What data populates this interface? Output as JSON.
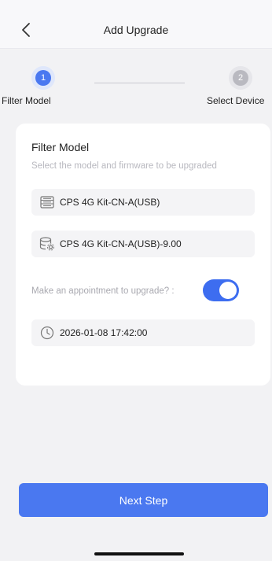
{
  "header": {
    "title": "Add Upgrade"
  },
  "stepper": {
    "steps": [
      {
        "number": "1",
        "label": "Filter Model",
        "active": true
      },
      {
        "number": "2",
        "label": "Select Device",
        "active": false
      }
    ]
  },
  "card": {
    "title": "Filter Model",
    "subtitle": "Select the model and firmware to be upgraded",
    "model_value": "CPS 4G Kit-CN-A(USB)",
    "firmware_value": "CPS 4G Kit-CN-A(USB)-9.00",
    "appointment_label": "Make an appointment to upgrade? :",
    "appointment_enabled": true,
    "datetime_value": "2026-01-08 17:42:00"
  },
  "footer": {
    "next_label": "Next Step"
  },
  "colors": {
    "accent": "#4a78f0",
    "background": "#f2f2f4"
  }
}
